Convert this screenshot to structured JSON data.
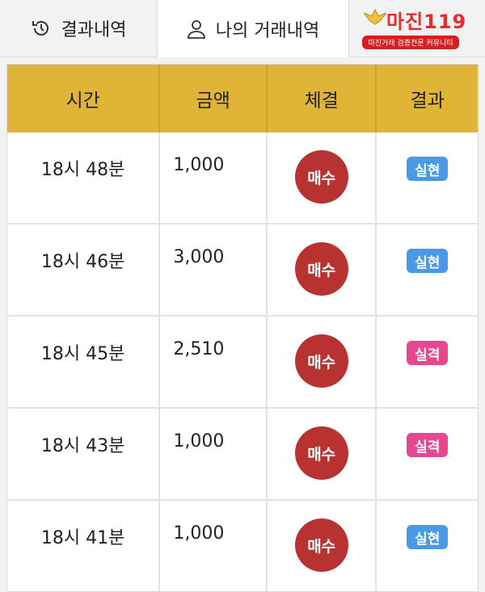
{
  "tabs": [
    {
      "label": "결과내역",
      "icon": "history-icon"
    },
    {
      "label": "나의 거래내역",
      "icon": "user-icon"
    }
  ],
  "logo": {
    "main": "마진119",
    "sub": "마진거래 검증전문 커뮤니티"
  },
  "table": {
    "headers": [
      "시간",
      "금액",
      "체결",
      "결과"
    ],
    "rows": [
      {
        "time": "18시 48분",
        "amount": "1,000",
        "execution": "매수",
        "result": "실현"
      },
      {
        "time": "18시 46분",
        "amount": "3,000",
        "execution": "매수",
        "result": "실현"
      },
      {
        "time": "18시 45분",
        "amount": "2,510",
        "execution": "매수",
        "result": "실격"
      },
      {
        "time": "18시 43분",
        "amount": "1,000",
        "execution": "매수",
        "result": "실격"
      },
      {
        "time": "18시 41분",
        "amount": "1,000",
        "execution": "매수",
        "result": "실현"
      }
    ]
  },
  "colors": {
    "header_bg": "#e0b437",
    "buy": "#b73230",
    "realized": "#4a98e8",
    "failed": "#e6488f"
  }
}
